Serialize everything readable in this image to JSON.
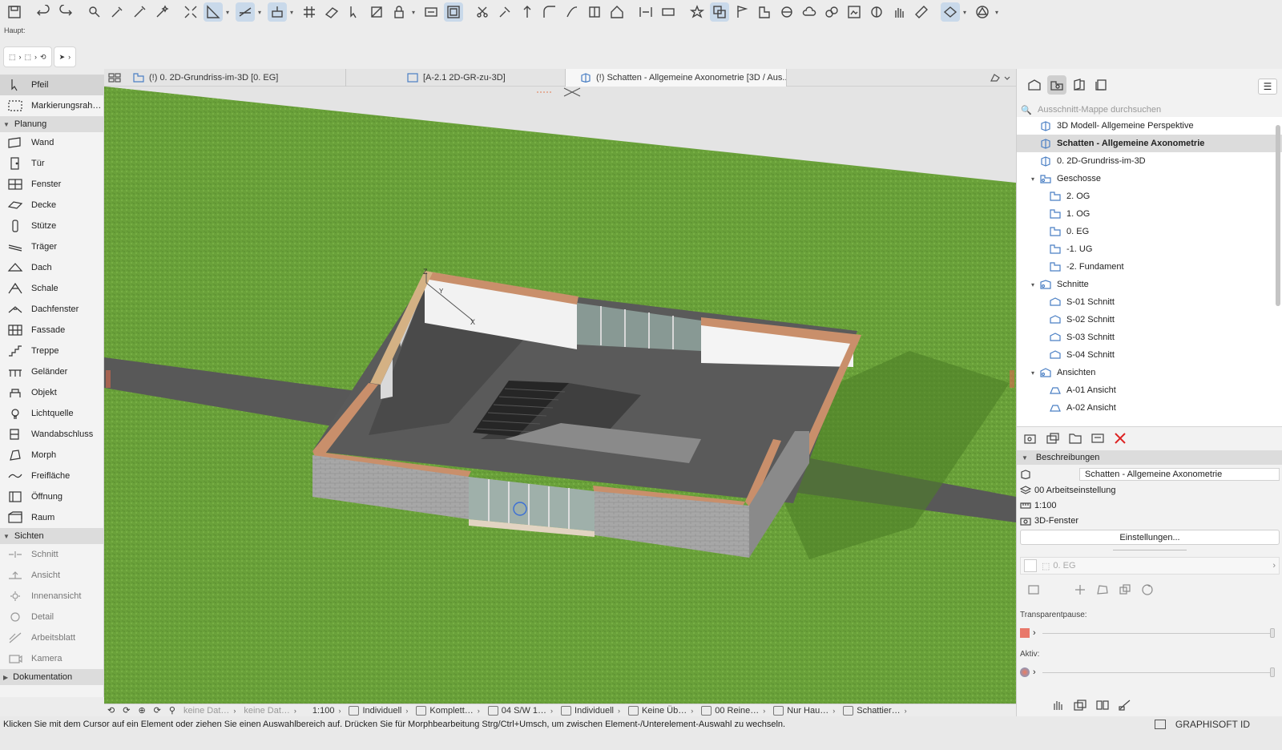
{
  "colors": {
    "grass": "#6aa13a",
    "accent_blue": "#4a7fc4",
    "selection_gray": "#d4d4d4",
    "delete_red": "#dd2222"
  },
  "toolbar": {
    "icons": [
      "save-icon",
      "undo-icon",
      "redo-icon",
      "find-select-icon",
      "eyedropper-icon",
      "syringe-icon",
      "magic-wand-icon",
      "fit-icon",
      "snap-guides-icon",
      "guide-lines-icon",
      "gravity-icon",
      "grid-snap-icon",
      "layer-filter-icon",
      "arrow-tool-icon",
      "transform-icon",
      "lock-icon",
      "renovation-icon",
      "trim-icon",
      "adjust-icon",
      "intersect-icon",
      "fillet-icon",
      "offset-icon",
      "explode-icon",
      "align-icon",
      "distribute-icon",
      "favorites-icon",
      "view-icon",
      "flag-icon",
      "issue-icon",
      "team-icon",
      "layout-icon",
      "publish-icon",
      "hotlink-icon",
      "measure-icon",
      "shape-icon",
      "globe-icon"
    ]
  },
  "toolbar2": {
    "label": "Haupt:"
  },
  "toolbox": {
    "arrow": "Pfeil",
    "marquee": "Markierungsrah…",
    "sections": {
      "planung": "Planung",
      "sichten": "Sichten",
      "dokumentation": "Dokumentation"
    },
    "planung_tools": [
      "Wand",
      "Tür",
      "Fenster",
      "Decke",
      "Stütze",
      "Träger",
      "Dach",
      "Schale",
      "Dachfenster",
      "Fassade",
      "Treppe",
      "Geländer",
      "Objekt",
      "Lichtquelle",
      "Wandabschluss",
      "Morph",
      "Freifläche",
      "Öffnung",
      "Raum"
    ],
    "sichten_tools": [
      "Schnitt",
      "Ansicht",
      "Innenansicht",
      "Detail",
      "Arbeitsblatt",
      "Kamera"
    ]
  },
  "tabs": [
    {
      "label": "(!) 0. 2D-Grundriss-im-3D [0. EG]",
      "active": false
    },
    {
      "label": "[A-2.1 2D-GR-zu-3D]",
      "active": false
    },
    {
      "label": "(!) Schatten - Allgemeine Axonometrie [3D / Aus...",
      "active": true
    }
  ],
  "viewport": {
    "axis_labels": {
      "z": "Z",
      "x": "X",
      "y": "Y"
    }
  },
  "viewbar": {
    "dim1": "keine Dat…",
    "dim2": "keine Dat…",
    "scale": "1:100",
    "layer_combo": "Individuell",
    "model_view": "Komplett…",
    "pen_set": "04 S/W 1…",
    "display": "Individuell",
    "overrides": "Keine Üb…",
    "renovation": "00 Reine…",
    "structure": "Nur Hau…",
    "shadow": "Schattier…"
  },
  "statusline": {
    "text": "Klicken Sie mit dem Cursor auf ein Element oder ziehen Sie einen Auswahlbereich auf. Drücken Sie für Morphbearbeitung Strg/Ctrl+Umsch, um zwischen Element-/Unterelement-Auswahl zu wechseln."
  },
  "brand": {
    "label": "GRAPHISOFT ID"
  },
  "navigator": {
    "search_placeholder": "Ausschnitt-Mappe durchsuchen",
    "tree": [
      {
        "label": "3D Modell- Allgemeine Perspektive",
        "level": 1,
        "icon": "3d-view-icon",
        "selected": false
      },
      {
        "label": "Schatten - Allgemeine Axonometrie",
        "level": 1,
        "icon": "3d-view-icon",
        "selected": true
      },
      {
        "label": "0. 2D-Grundriss-im-3D",
        "level": 1,
        "icon": "3d-view-icon",
        "selected": false
      },
      {
        "label": "Geschosse",
        "level": 1,
        "icon": "stories-folder-icon",
        "selected": false,
        "expandable": true
      },
      {
        "label": "2. OG",
        "level": 2,
        "icon": "floor-plan-icon",
        "selected": false
      },
      {
        "label": "1. OG",
        "level": 2,
        "icon": "floor-plan-icon",
        "selected": false
      },
      {
        "label": "0. EG",
        "level": 2,
        "icon": "floor-plan-icon",
        "selected": false
      },
      {
        "label": "-1. UG",
        "level": 2,
        "icon": "floor-plan-icon",
        "selected": false
      },
      {
        "label": "-2. Fundament",
        "level": 2,
        "icon": "floor-plan-icon",
        "selected": false
      },
      {
        "label": "Schnitte",
        "level": 1,
        "icon": "sections-folder-icon",
        "selected": false,
        "expandable": true
      },
      {
        "label": "S-01 Schnitt",
        "level": 2,
        "icon": "section-icon",
        "selected": false
      },
      {
        "label": "S-02 Schnitt",
        "level": 2,
        "icon": "section-icon",
        "selected": false
      },
      {
        "label": "S-03 Schnitt",
        "level": 2,
        "icon": "section-icon",
        "selected": false
      },
      {
        "label": "S-04 Schnitt",
        "level": 2,
        "icon": "section-icon",
        "selected": false
      },
      {
        "label": "Ansichten",
        "level": 1,
        "icon": "elevations-folder-icon",
        "selected": false,
        "expandable": true
      },
      {
        "label": "A-01 Ansicht",
        "level": 2,
        "icon": "elevation-icon",
        "selected": false
      },
      {
        "label": "A-02 Ansicht",
        "level": 2,
        "icon": "elevation-icon",
        "selected": false
      }
    ],
    "properties_header": "Beschreibungen",
    "view_name": "Schatten - Allgemeine Axonometrie",
    "layer_combination": "00 Arbeitseinstellung",
    "scale": "1:100",
    "window_type": "3D-Fenster",
    "settings_button": "Einstellungen...",
    "story": "0. EG",
    "transparency_label": "Transparentpause:",
    "active_label": "Aktiv:"
  }
}
